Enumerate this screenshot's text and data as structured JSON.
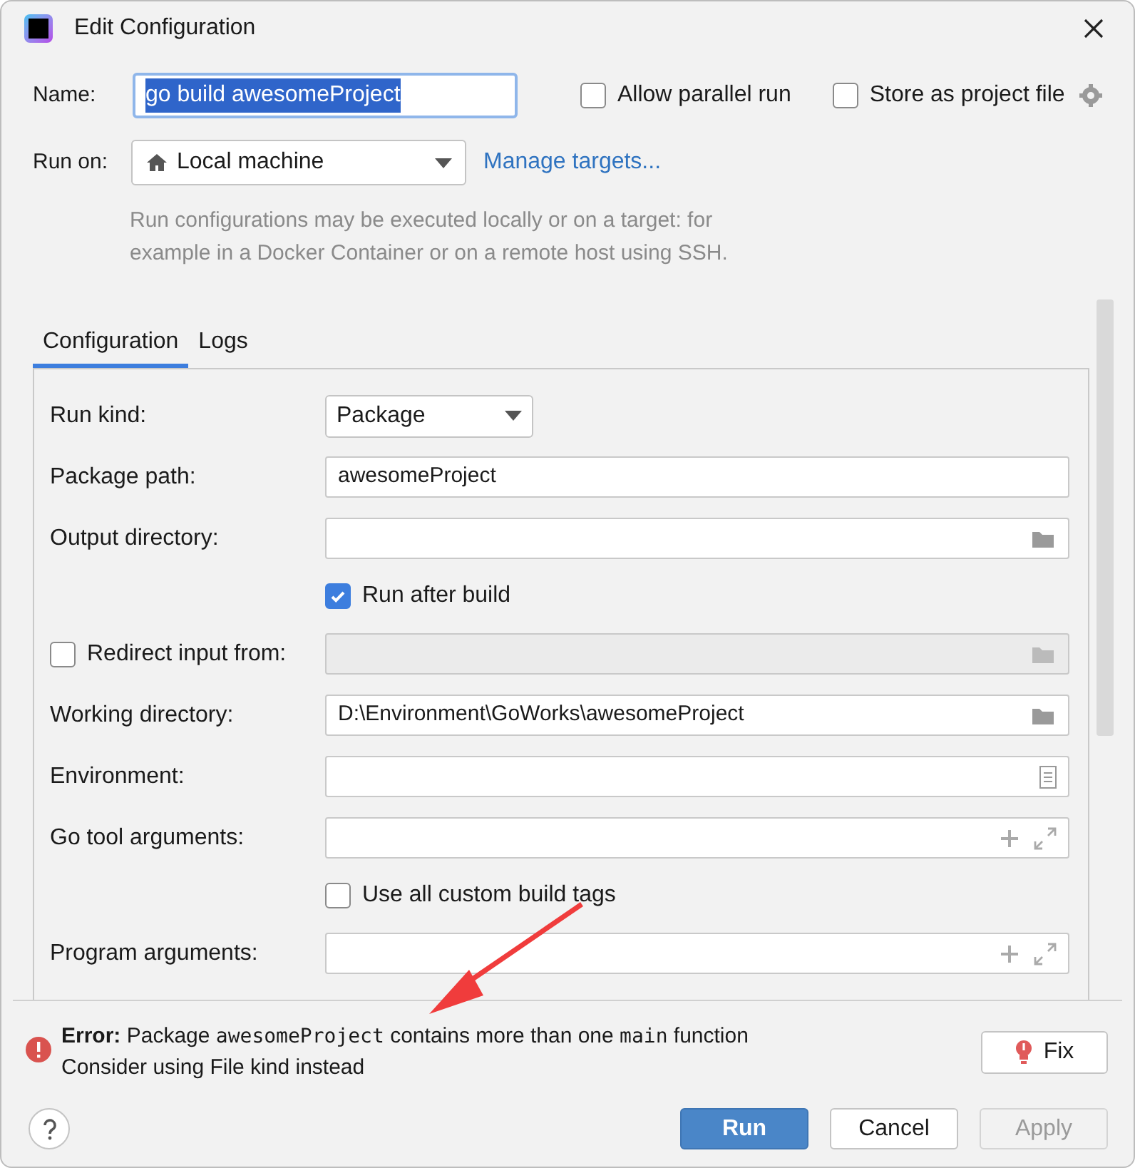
{
  "window": {
    "title": "Edit Configuration"
  },
  "name": {
    "label": "Name:",
    "value": "go build awesomeProject",
    "text_selected": true
  },
  "options": [
    {
      "label": "Allow parallel run",
      "checked": false
    },
    {
      "label": "Store as project file",
      "checked": false
    }
  ],
  "run_on": {
    "label": "Run on:",
    "value": "Local machine",
    "link": "Manage targets..."
  },
  "hint": "Run configurations may be executed locally or on a target: for example in a Docker Container or on a remote host using SSH.",
  "tabs": [
    {
      "label": "Configuration",
      "selected": true
    },
    {
      "label": "Logs",
      "selected": false
    }
  ],
  "rows": [
    {
      "kind": "dropdown",
      "label": "Run kind:",
      "value": "Package"
    },
    {
      "kind": "text",
      "label": "Package path:",
      "value": "awesomeProject"
    },
    {
      "kind": "browse",
      "label": "Output directory:",
      "value": ""
    },
    {
      "kind": "checkbox",
      "label": "Run after build",
      "checked": true
    },
    {
      "kind": "checkbox_browse",
      "label": "Redirect input from:",
      "checked": false,
      "disabled": true,
      "value": ""
    },
    {
      "kind": "browse",
      "label": "Working directory:",
      "value": "D:\\Environment\\GoWorks\\awesomeProject"
    },
    {
      "kind": "document",
      "label": "Environment:",
      "value": ""
    },
    {
      "kind": "expand",
      "label": "Go tool arguments:",
      "value": ""
    },
    {
      "kind": "checkbox",
      "label": "Use all custom build tags",
      "checked": false
    },
    {
      "kind": "expand",
      "label": "Program arguments:",
      "value": ""
    }
  ],
  "error": {
    "label": "Error:",
    "parts": [
      {
        "kind": "text",
        "text": " Package "
      },
      {
        "kind": "code",
        "text": "awesomeProject"
      },
      {
        "kind": "text",
        "text": " contains more than one "
      },
      {
        "kind": "code",
        "text": "main"
      },
      {
        "kind": "text",
        "text": " function"
      }
    ],
    "hint": "Consider using File kind instead",
    "fix": "Fix"
  },
  "buttons": [
    {
      "label": "Run",
      "default": true,
      "disabled": false
    },
    {
      "label": "Cancel",
      "default": false,
      "disabled": false
    },
    {
      "label": "Apply",
      "default": false,
      "disabled": true
    }
  ]
}
